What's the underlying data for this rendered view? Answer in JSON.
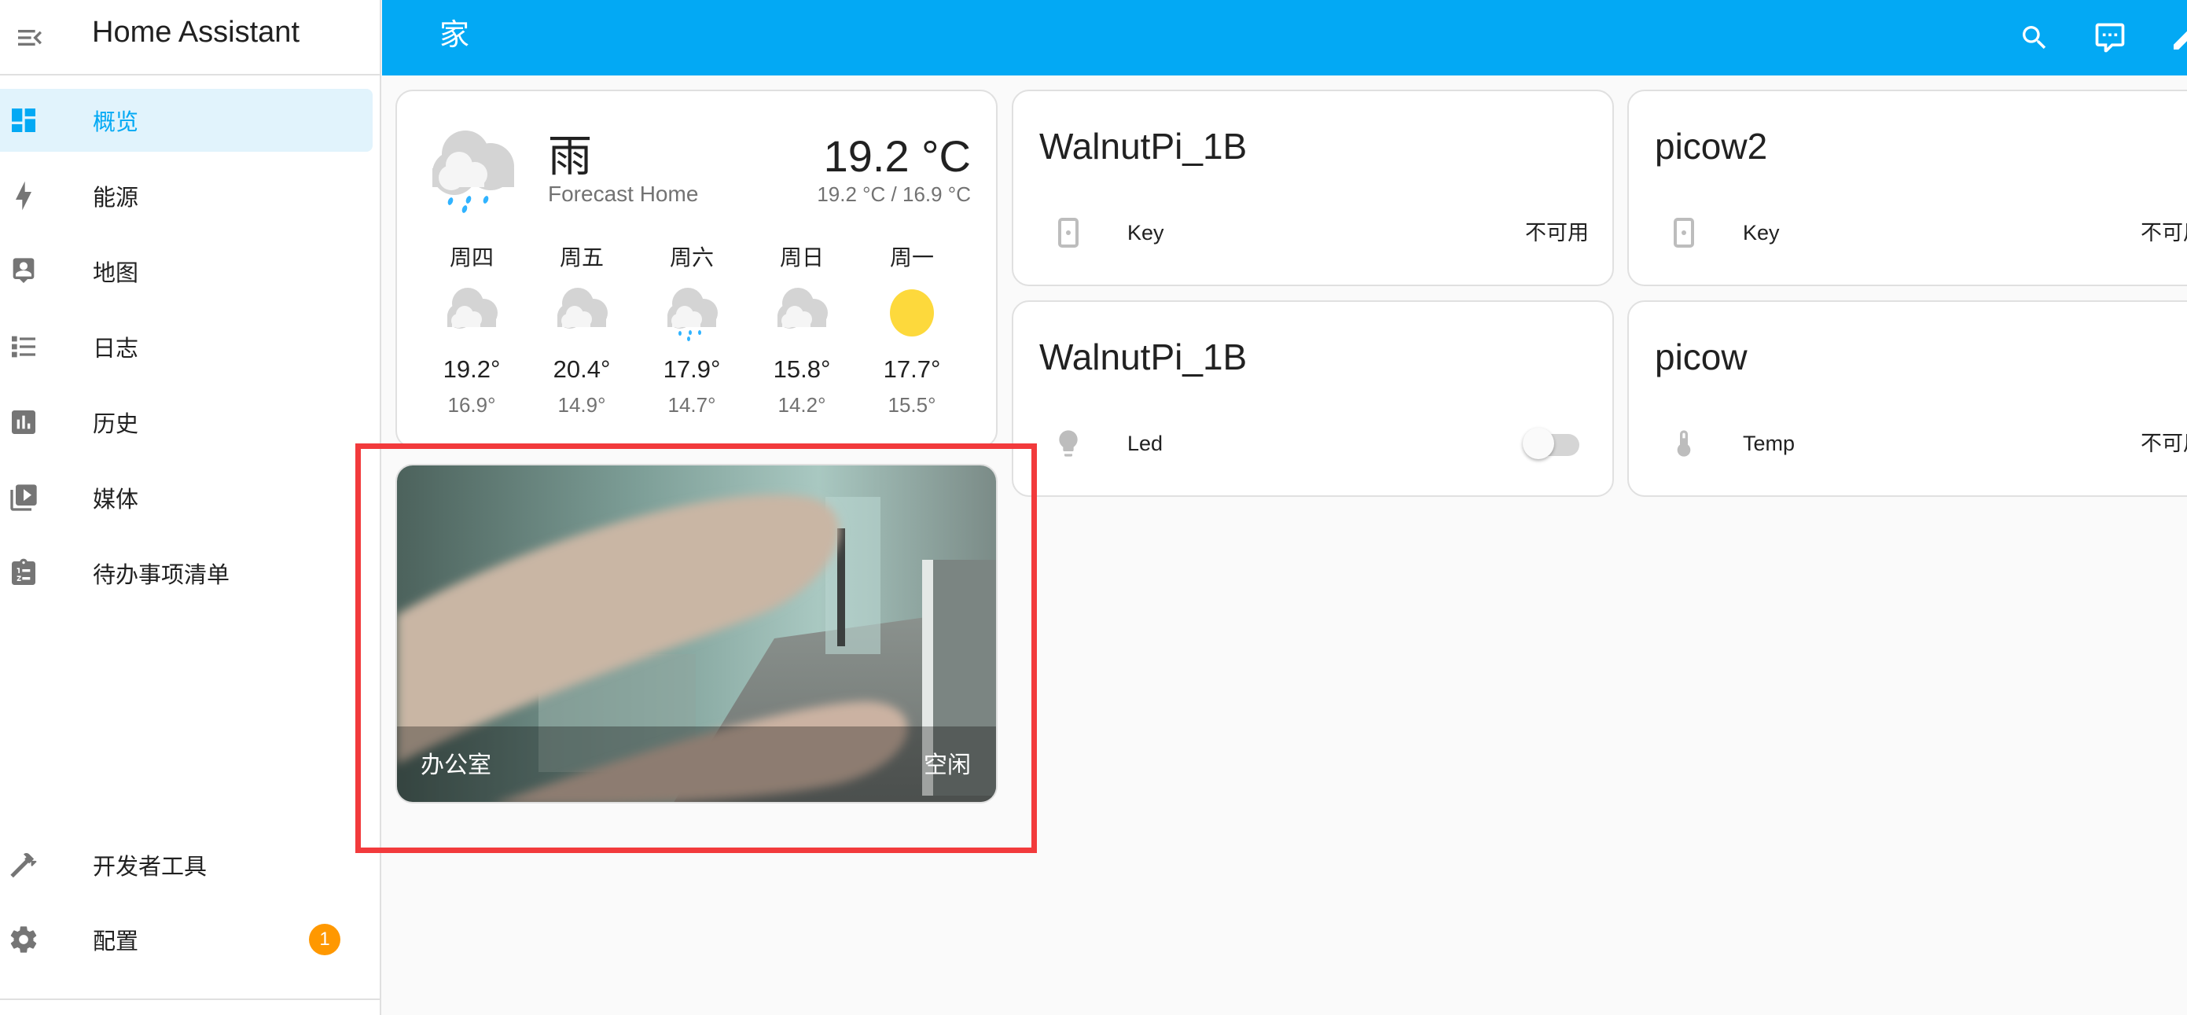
{
  "sidebar": {
    "app_title": "Home Assistant",
    "items": [
      {
        "label": "概览",
        "icon": "dashboard-icon",
        "active": true
      },
      {
        "label": "能源",
        "icon": "lightning-bolt-icon"
      },
      {
        "label": "地图",
        "icon": "map-account-icon"
      },
      {
        "label": "日志",
        "icon": "format-list-icon"
      },
      {
        "label": "历史",
        "icon": "chart-box-icon"
      },
      {
        "label": "媒体",
        "icon": "play-box-multiple-icon"
      },
      {
        "label": "待办事项清单",
        "icon": "clipboard-list-icon"
      }
    ],
    "bottom_items": [
      {
        "label": "开发者工具",
        "icon": "hammer-icon"
      },
      {
        "label": "配置",
        "icon": "cog-icon",
        "badge": "1"
      }
    ]
  },
  "header": {
    "title": "家",
    "actions": [
      "search-icon",
      "assist-icon",
      "edit-icon"
    ]
  },
  "weather": {
    "condition": "雨",
    "name": "Forecast Home",
    "temperature": "19.2 °C",
    "hi_lo": "19.2 °C / 16.9 °C",
    "forecast": [
      {
        "day": "周四",
        "icon": "cloudy",
        "high": "19.2°",
        "low": "16.9°"
      },
      {
        "day": "周五",
        "icon": "cloudy",
        "high": "20.4°",
        "low": "14.9°"
      },
      {
        "day": "周六",
        "icon": "rainy",
        "high": "17.9°",
        "low": "14.7°"
      },
      {
        "day": "周日",
        "icon": "cloudy",
        "high": "15.8°",
        "low": "14.2°"
      },
      {
        "day": "周一",
        "icon": "sunny",
        "high": "17.7°",
        "low": "15.5°"
      }
    ]
  },
  "camera": {
    "name": "办公室",
    "state": "空闲"
  },
  "entity_cards": [
    {
      "title": "WalnutPi_1B",
      "row": {
        "name": "Key",
        "icon": "gesture-tap-button-icon",
        "state": "不可用"
      }
    },
    {
      "title": "WalnutPi_1B",
      "row": {
        "name": "Led",
        "icon": "lightbulb-icon",
        "toggle": false
      }
    },
    {
      "title": "picow2",
      "row": {
        "name": "Key",
        "icon": "gesture-tap-button-icon",
        "state": "不可用"
      }
    },
    {
      "title": "picow",
      "row": {
        "name": "Temp",
        "icon": "thermometer-icon",
        "state": "不可用"
      }
    }
  ],
  "colors": {
    "primary": "#03a9f4",
    "active_bg": "#e1f3fc",
    "badge": "#ff9800",
    "sun": "#fdd93c",
    "rain": "#30b3ff",
    "annotation": "#f23a3c"
  }
}
